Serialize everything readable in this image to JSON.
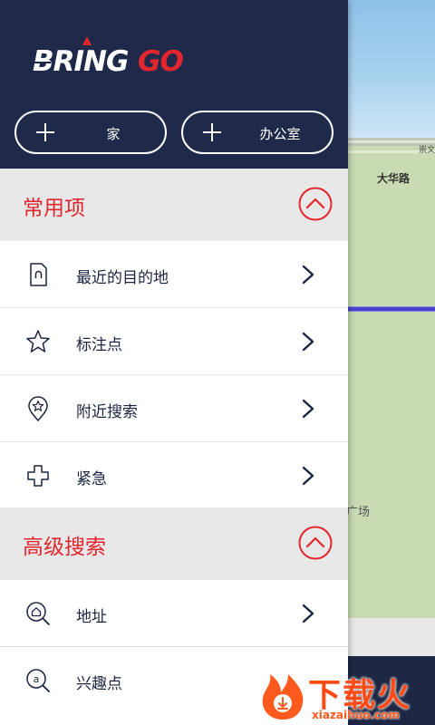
{
  "app": {
    "brand": "BRINGGO",
    "brand_color": "#1f294a",
    "accent_color": "#e1262d"
  },
  "map": {
    "labels": [
      "崇文",
      "大华路",
      "广场"
    ]
  },
  "shortcuts": {
    "home_label": "家",
    "office_label": "办公室"
  },
  "sections": [
    {
      "title": "常用项",
      "items": [
        {
          "label": "最近的目的地",
          "icon": "recent-destination-icon"
        },
        {
          "label": "标注点",
          "icon": "star-icon"
        },
        {
          "label": "附近搜索",
          "icon": "nearby-search-icon"
        },
        {
          "label": "紧急",
          "icon": "cross-icon"
        }
      ]
    },
    {
      "title": "高级搜索",
      "items": [
        {
          "label": "地址",
          "icon": "address-search-icon"
        },
        {
          "label": "兴趣点",
          "icon": "poi-search-icon"
        }
      ]
    }
  ],
  "watermark": {
    "text": "下载火",
    "url": "xiazaihuo.com"
  }
}
